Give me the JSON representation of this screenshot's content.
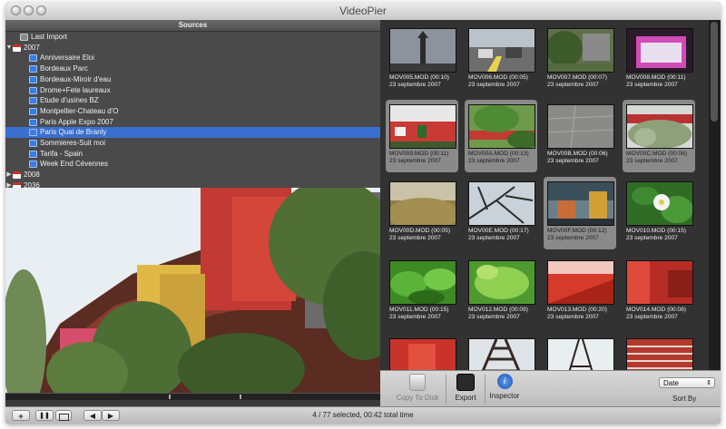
{
  "window": {
    "title": "VideoPier"
  },
  "sources": {
    "header": "Sources",
    "items": [
      {
        "label": "Last Import",
        "icon": "import-icon",
        "level": 1,
        "expander": ""
      },
      {
        "label": "2007",
        "icon": "calendar-icon",
        "level": 0,
        "expander": "▼"
      },
      {
        "label": "Anniversaire Eloi",
        "icon": "folder-icon",
        "level": 2,
        "expander": ""
      },
      {
        "label": "Bordeaux Parc",
        "icon": "folder-icon",
        "level": 2,
        "expander": ""
      },
      {
        "label": "Bordeaux-Miroir d'eau",
        "icon": "folder-icon",
        "level": 2,
        "expander": ""
      },
      {
        "label": "Drome+Fete laureaux",
        "icon": "folder-icon",
        "level": 2,
        "expander": ""
      },
      {
        "label": "Etude d'usines BZ",
        "icon": "folder-icon",
        "level": 2,
        "expander": ""
      },
      {
        "label": "Montpellier-Chateau d'O",
        "icon": "folder-icon",
        "level": 2,
        "expander": ""
      },
      {
        "label": "Paris Apple Expo 2007",
        "icon": "folder-icon",
        "level": 2,
        "expander": ""
      },
      {
        "label": "Paris Quai de Branly",
        "icon": "folder-icon",
        "level": 2,
        "expander": "",
        "selected": true
      },
      {
        "label": "Sommieres-Suit moi",
        "icon": "folder-icon",
        "level": 2,
        "expander": ""
      },
      {
        "label": "Tarifa - Spain",
        "icon": "folder-icon",
        "level": 2,
        "expander": ""
      },
      {
        "label": "Week End Cévennes",
        "icon": "folder-icon",
        "level": 2,
        "expander": ""
      },
      {
        "label": "2008",
        "icon": "calendar-icon",
        "level": 0,
        "expander": "▶"
      },
      {
        "label": "2036",
        "icon": "calendar-icon",
        "level": 0,
        "expander": "▶"
      }
    ]
  },
  "clips": [
    {
      "name": "MOV005.MOD (00:10)",
      "date": "23 septembre 2007",
      "selected": false,
      "scene": "tower"
    },
    {
      "name": "MOV006.MOD (00:05)",
      "date": "23 septembre 2007",
      "selected": false,
      "scene": "street"
    },
    {
      "name": "MOV007.MOD (00:07)",
      "date": "23 septembre 2007",
      "selected": false,
      "scene": "garden"
    },
    {
      "name": "MOV008.MOD (00:11)",
      "date": "23 septembre 2007",
      "selected": false,
      "scene": "pink"
    },
    {
      "name": "MOV009.MOD (00:11)",
      "date": "23 septembre 2007",
      "selected": true,
      "scene": "building"
    },
    {
      "name": "MOV00A.MOD (00:13)",
      "date": "23 septembre 2007",
      "selected": true,
      "scene": "greenbuild"
    },
    {
      "name": "MOV00B.MOD (00:06)",
      "date": "23 septembre 2007",
      "selected": false,
      "scene": "pavement"
    },
    {
      "name": "MOV00C.MOD (00:06)",
      "date": "23 septembre 2007",
      "selected": true,
      "scene": "plants"
    },
    {
      "name": "MOV00D.MOD (00:05)",
      "date": "23 septembre 2007",
      "selected": false,
      "scene": "grass"
    },
    {
      "name": "MOV00E.MOD (00:17)",
      "date": "23 septembre 2007",
      "selected": false,
      "scene": "branches"
    },
    {
      "name": "MOV00F.MOD (00:12)",
      "date": "23 septembre 2007",
      "selected": true,
      "scene": "facade"
    },
    {
      "name": "MOV010.MOD (00:15)",
      "date": "23 septembre 2007",
      "selected": false,
      "scene": "flower"
    },
    {
      "name": "MOV011.MOD (00:15)",
      "date": "23 septembre 2007",
      "selected": false,
      "scene": "leaves"
    },
    {
      "name": "MOV012.MOD (00:09)",
      "date": "23 septembre 2007",
      "selected": false,
      "scene": "leaves2"
    },
    {
      "name": "MOV013.MOD (00:20)",
      "date": "23 septembre 2007",
      "selected": false,
      "scene": "red"
    },
    {
      "name": "MOV014.MOD (00:08)",
      "date": "23 septembre 2007",
      "selected": false,
      "scene": "red2"
    },
    {
      "name": "",
      "date": "",
      "selected": false,
      "scene": "red3"
    },
    {
      "name": "",
      "date": "",
      "selected": false,
      "scene": "eiffel"
    },
    {
      "name": "",
      "date": "",
      "selected": false,
      "scene": "eiffel2"
    },
    {
      "name": "",
      "date": "",
      "selected": false,
      "scene": "stairs"
    }
  ],
  "toolbar": {
    "copy_to_disk": "Copy To Disk",
    "export": "Export",
    "inspector": "Inspector",
    "sort_value": "Date",
    "sort_label": "Sort By"
  },
  "bottom": {
    "add": "+",
    "pause": "❚❚",
    "prev": "◀",
    "next": "▶",
    "status": "4 / 77 selected, 00:42 total time"
  },
  "colors": {
    "selection": "#3a6fd0",
    "pane_bg": "#323232"
  }
}
